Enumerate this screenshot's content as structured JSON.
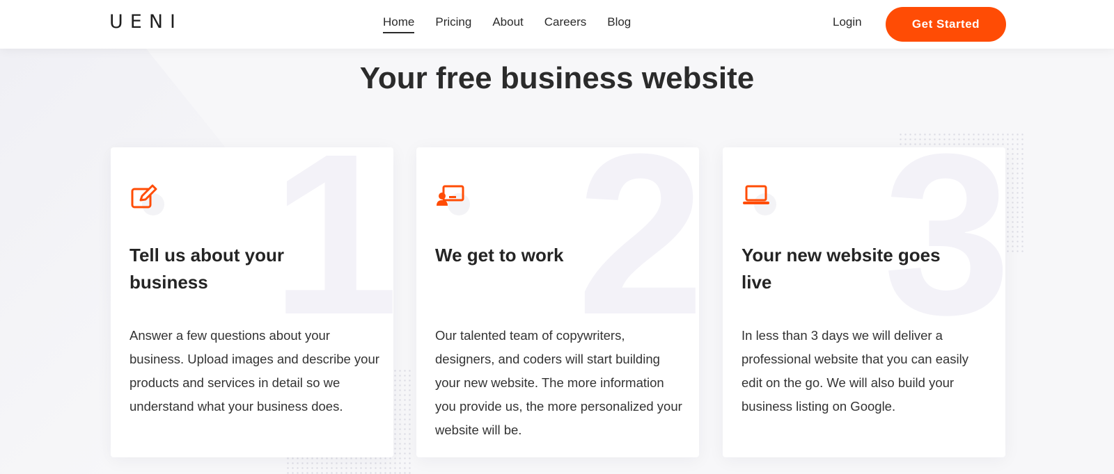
{
  "brand": {
    "logo": "UENI",
    "accent_color": "#ff4c05"
  },
  "nav": {
    "items": [
      {
        "label": "Home",
        "active": true
      },
      {
        "label": "Pricing",
        "active": false
      },
      {
        "label": "About",
        "active": false
      },
      {
        "label": "Careers",
        "active": false
      },
      {
        "label": "Blog",
        "active": false
      }
    ],
    "login_label": "Login",
    "cta_label": "Get Started"
  },
  "main": {
    "title": "Your free business website",
    "cards": [
      {
        "number": "1",
        "icon": "edit-icon",
        "title": "Tell us about your business",
        "text": "Answer a few questions about your business. Upload images and describe your products and services in detail so we understand what your business does."
      },
      {
        "number": "2",
        "icon": "presenter-icon",
        "title": "We get to work",
        "text": "Our talented team of copywriters, designers, and coders will start building your new website. The more information you provide us, the more personalized your website will be."
      },
      {
        "number": "3",
        "icon": "laptop-icon",
        "title": "Your new website goes live",
        "text": "In less than 3 days we will deliver a professional website that you can easily edit on the go. We will also build your business listing on Google."
      }
    ]
  }
}
